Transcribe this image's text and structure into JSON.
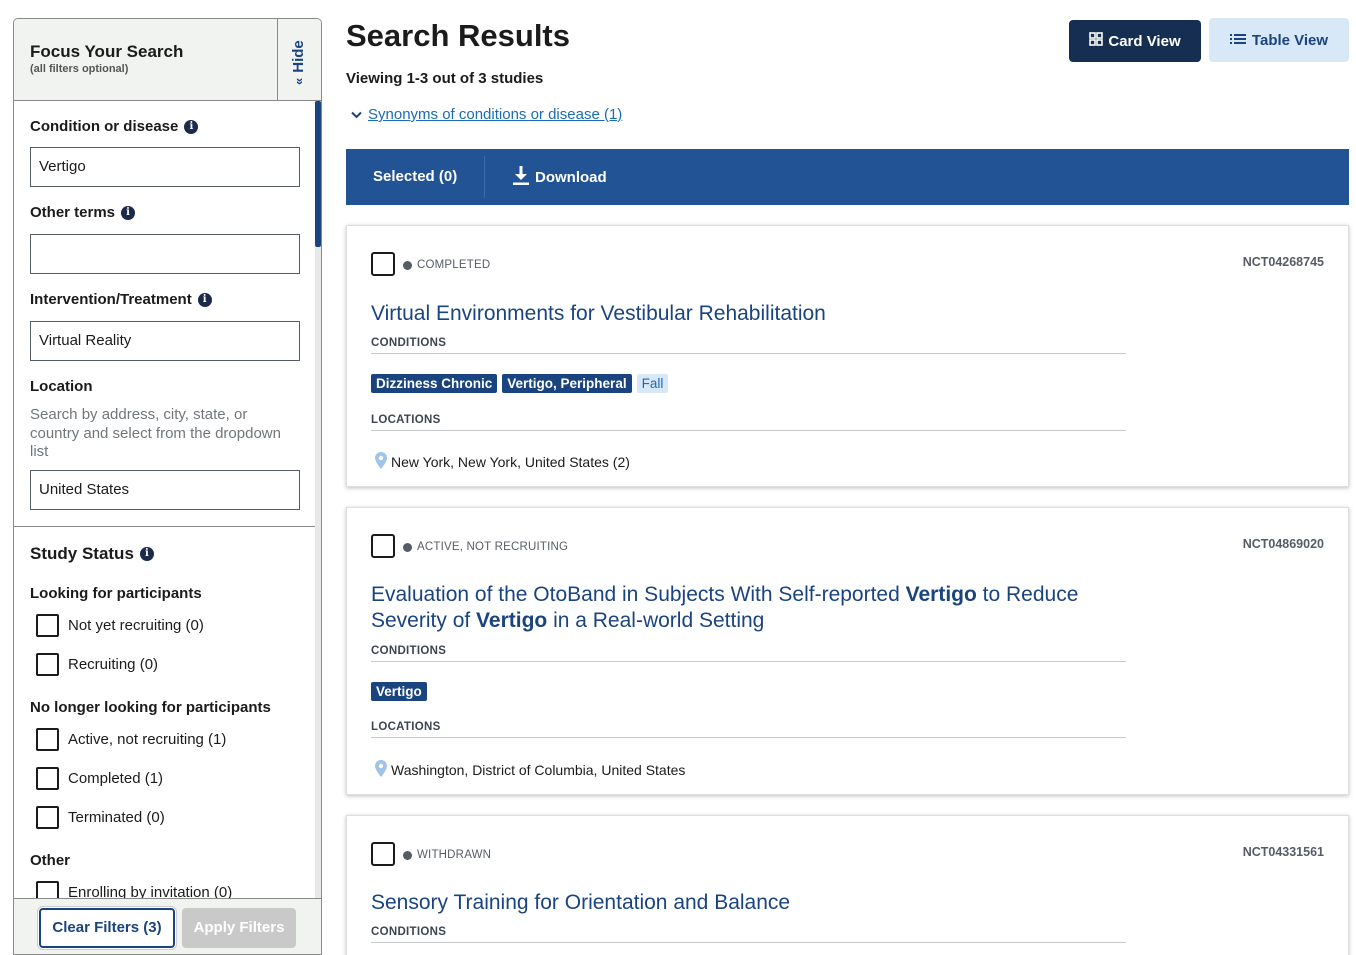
{
  "sidebar": {
    "title": "Focus Your Search",
    "subtitle": "(all filters optional)",
    "hide_label": "Hide",
    "condition": {
      "label": "Condition or disease",
      "value": "Vertigo"
    },
    "other_terms": {
      "label": "Other terms",
      "value": ""
    },
    "intervention": {
      "label": "Intervention/Treatment",
      "value": "Virtual Reality"
    },
    "location": {
      "label": "Location",
      "hint": "Search by address, city, state, or country and select from the dropdown list",
      "value": "United States"
    },
    "study_status": {
      "title": "Study Status",
      "looking_heading": "Looking for participants",
      "looking": [
        {
          "label": "Not yet recruiting (0)",
          "checked": false
        },
        {
          "label": "Recruiting (0)",
          "checked": false
        }
      ],
      "no_longer_heading": "No longer looking for participants",
      "no_longer": [
        {
          "label": "Active, not recruiting (1)",
          "checked": false
        },
        {
          "label": "Completed (1)",
          "checked": false
        },
        {
          "label": "Terminated (0)",
          "checked": false
        }
      ],
      "other_heading": "Other",
      "other": [
        {
          "label": "Enrolling by invitation (0)",
          "checked": false
        }
      ]
    },
    "clear_label": "Clear Filters (3)",
    "apply_label": "Apply Filters"
  },
  "main": {
    "title": "Search Results",
    "viewing": "Viewing 1-3 out of 3 studies",
    "synonyms_link": "Synonyms of conditions or disease (1)",
    "card_view_label": "Card View",
    "table_view_label": "Table View",
    "toolbar": {
      "selected_label": "Selected (0)",
      "download_label": "Download"
    },
    "conditions_label": "CONDITIONS",
    "locations_label": "LOCATIONS",
    "studies": [
      {
        "status": "COMPLETED",
        "nct": "NCT04268745",
        "title_parts": [
          {
            "text": "Virtual Environments for Vestibular Rehabilitation",
            "bold": false
          }
        ],
        "conditions": [
          {
            "label": "Dizziness Chronic",
            "highlight": true
          },
          {
            "label": "Vertigo, Peripheral",
            "highlight": true
          },
          {
            "label": "Fall",
            "highlight": false
          }
        ],
        "location": "New York, New York, United States (2)"
      },
      {
        "status": "ACTIVE, NOT RECRUITING",
        "nct": "NCT04869020",
        "title_parts": [
          {
            "text": "Evaluation of the OtoBand in Subjects With Self-reported ",
            "bold": false
          },
          {
            "text": "Vertigo",
            "bold": true
          },
          {
            "text": " to Reduce Severity of ",
            "bold": false
          },
          {
            "text": "Vertigo",
            "bold": true
          },
          {
            "text": " in a Real-world Setting",
            "bold": false
          }
        ],
        "conditions": [
          {
            "label": "Vertigo",
            "highlight": true
          }
        ],
        "location": "Washington, District of Columbia, United States"
      },
      {
        "status": "WITHDRAWN",
        "nct": "NCT04331561",
        "title_parts": [
          {
            "text": "Sensory Training for Orientation and Balance",
            "bold": false
          }
        ],
        "conditions": [],
        "location": ""
      }
    ]
  },
  "colors": {
    "primary_dark": "#162e51",
    "primary": "#1a4480",
    "toolbar": "#225395",
    "link": "#1a6bb8",
    "tag_light_bg": "#d9e8f6"
  },
  "icons": {
    "info": "info-icon",
    "hide": "chevron-double-left-icon",
    "card_view": "grid-icon",
    "table_view": "list-icon",
    "download": "download-icon",
    "location": "map-pin-icon",
    "synonyms": "chevron-down-icon"
  }
}
